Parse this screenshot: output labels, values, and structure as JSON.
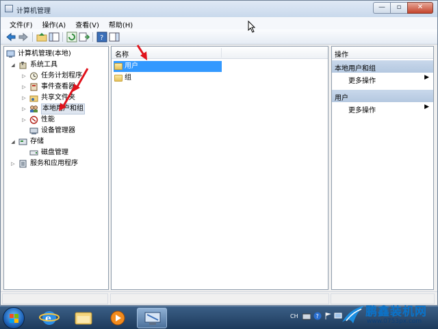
{
  "window": {
    "title": "计算机管理",
    "caption": {
      "minimize": "—",
      "maximize": "▫",
      "close": "✕"
    }
  },
  "menu": [
    "文件(F)",
    "操作(A)",
    "查看(V)",
    "帮助(H)"
  ],
  "tree": [
    {
      "label": "计算机管理(本地)",
      "icon": "computer-management-icon"
    },
    {
      "label": "系统工具",
      "icon": "tools-icon"
    },
    {
      "label": "任务计划程序",
      "icon": "clock-icon"
    },
    {
      "label": "事件查看器",
      "icon": "event-viewer-icon"
    },
    {
      "label": "共享文件夹",
      "icon": "shared-folder-icon"
    },
    {
      "label": "本地用户和组",
      "icon": "users-icon",
      "selected": true
    },
    {
      "label": "性能",
      "icon": "performance-icon"
    },
    {
      "label": "设备管理器",
      "icon": "device-manager-icon"
    },
    {
      "label": "存储",
      "icon": "storage-icon"
    },
    {
      "label": "磁盘管理",
      "icon": "disk-icon"
    },
    {
      "label": "服务和应用程序",
      "icon": "services-icon"
    }
  ],
  "list": {
    "column": "名称",
    "rows": [
      {
        "label": "用户",
        "selected": true
      },
      {
        "label": "组",
        "selected": false
      }
    ]
  },
  "actions": {
    "title": "操作",
    "groups": [
      {
        "label": "本地用户和组",
        "item": "更多操作"
      },
      {
        "label": "用户",
        "item": "更多操作"
      }
    ]
  },
  "taskbar": {
    "tray_lang": "CH",
    "apps": [
      "ie-icon",
      "explorer-icon",
      "media-player-icon",
      "computer-management-icon"
    ]
  },
  "watermark": {
    "title": "鹏鑫装机网",
    "url": "www.0753px.com"
  },
  "colors": {
    "selection": "#3399ff",
    "action_group": "#c9d8eb",
    "taskbar": "#1d3a5c",
    "annotation_arrow": "#e0121b"
  }
}
